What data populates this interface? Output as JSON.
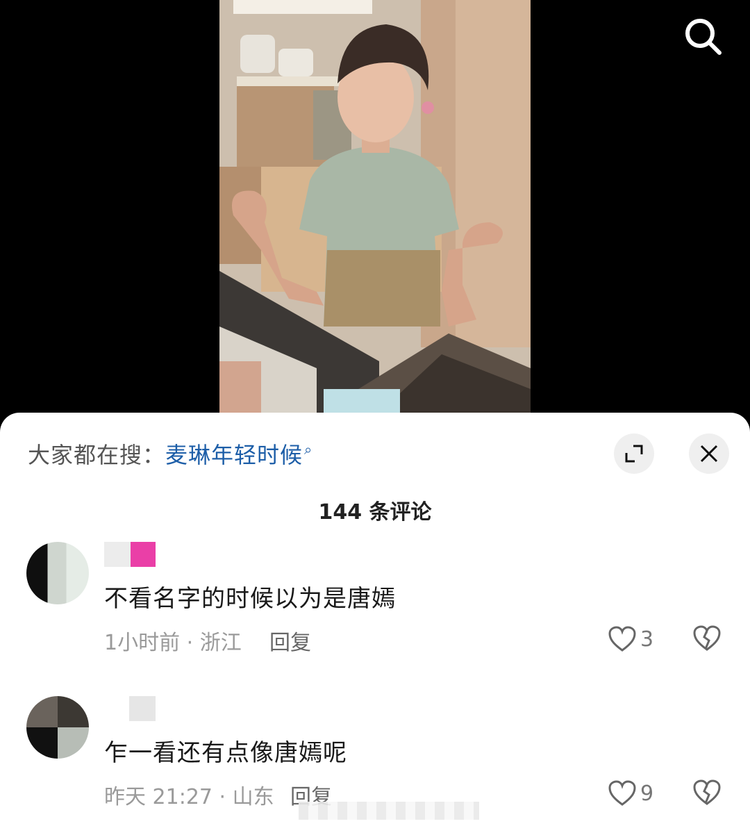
{
  "hot_search": {
    "prefix": "大家都在搜：",
    "keyword": "麦琳年轻时候",
    "keyword_icon": "search-icon"
  },
  "comment_count": "144 条评论",
  "comments": [
    {
      "text": "不看名字的时候以为是唐嫣",
      "meta": "1小时前 · 浙江",
      "reply_label": "回复",
      "likes": "3"
    },
    {
      "text": "乍一看还有点像唐嫣呢",
      "meta": "昨天 21:27 · 山东",
      "reply_label": "回复",
      "likes": "9"
    }
  ],
  "icons": {
    "search": "search-icon",
    "expand": "expand-icon",
    "close": "close-icon",
    "like": "heart-icon",
    "dislike": "broken-heart-icon"
  },
  "colors": {
    "keyword": "#1d5ea8",
    "username_mosaic": "#ea3fa7"
  }
}
